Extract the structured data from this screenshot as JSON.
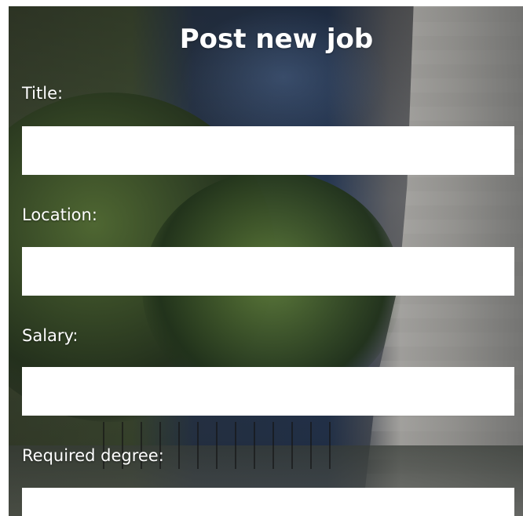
{
  "form": {
    "title": "Post new job",
    "fields": [
      {
        "label": "Title:",
        "value": "",
        "placeholder": ""
      },
      {
        "label": "Location:",
        "value": "",
        "placeholder": ""
      },
      {
        "label": "Salary:",
        "value": "",
        "placeholder": ""
      },
      {
        "label": "Required degree:",
        "value": "",
        "placeholder": ""
      }
    ]
  }
}
